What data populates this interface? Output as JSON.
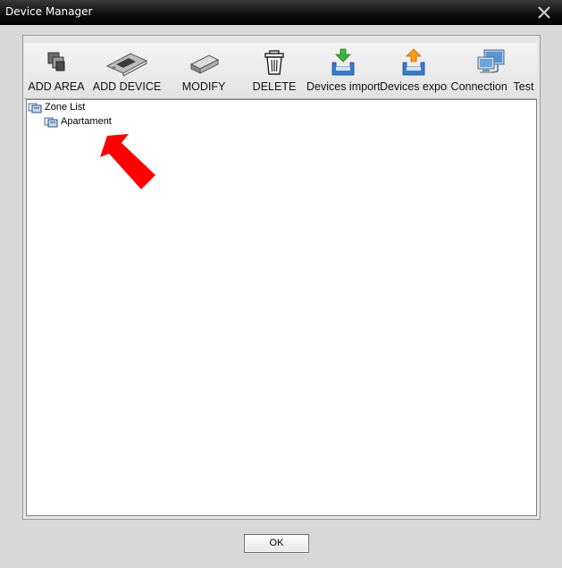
{
  "window": {
    "title": "Device Manager",
    "close_glyph": "✕"
  },
  "toolbar": {
    "buttons": [
      {
        "label": "ADD AREA",
        "icon": "add-area-icon"
      },
      {
        "label": "ADD DEVICE",
        "icon": "add-device-icon"
      },
      {
        "label": "MODIFY",
        "icon": "modify-icon"
      },
      {
        "label": "DELETE",
        "icon": "trash-icon"
      },
      {
        "label": "Devices import",
        "icon": "import-icon"
      },
      {
        "label": "Devices expor",
        "icon": "export-icon"
      },
      {
        "label": "Connection  Test",
        "icon": "connection-test-icon"
      }
    ]
  },
  "tree": {
    "root": {
      "label": "Zone List",
      "icon": "zone-folder-icon"
    },
    "children": [
      {
        "label": "Apartament",
        "icon": "zone-folder-icon"
      }
    ]
  },
  "annotation": {
    "icon": "red-arrow-icon",
    "color": "#ff0000"
  },
  "footer": {
    "ok_label": "OK"
  }
}
